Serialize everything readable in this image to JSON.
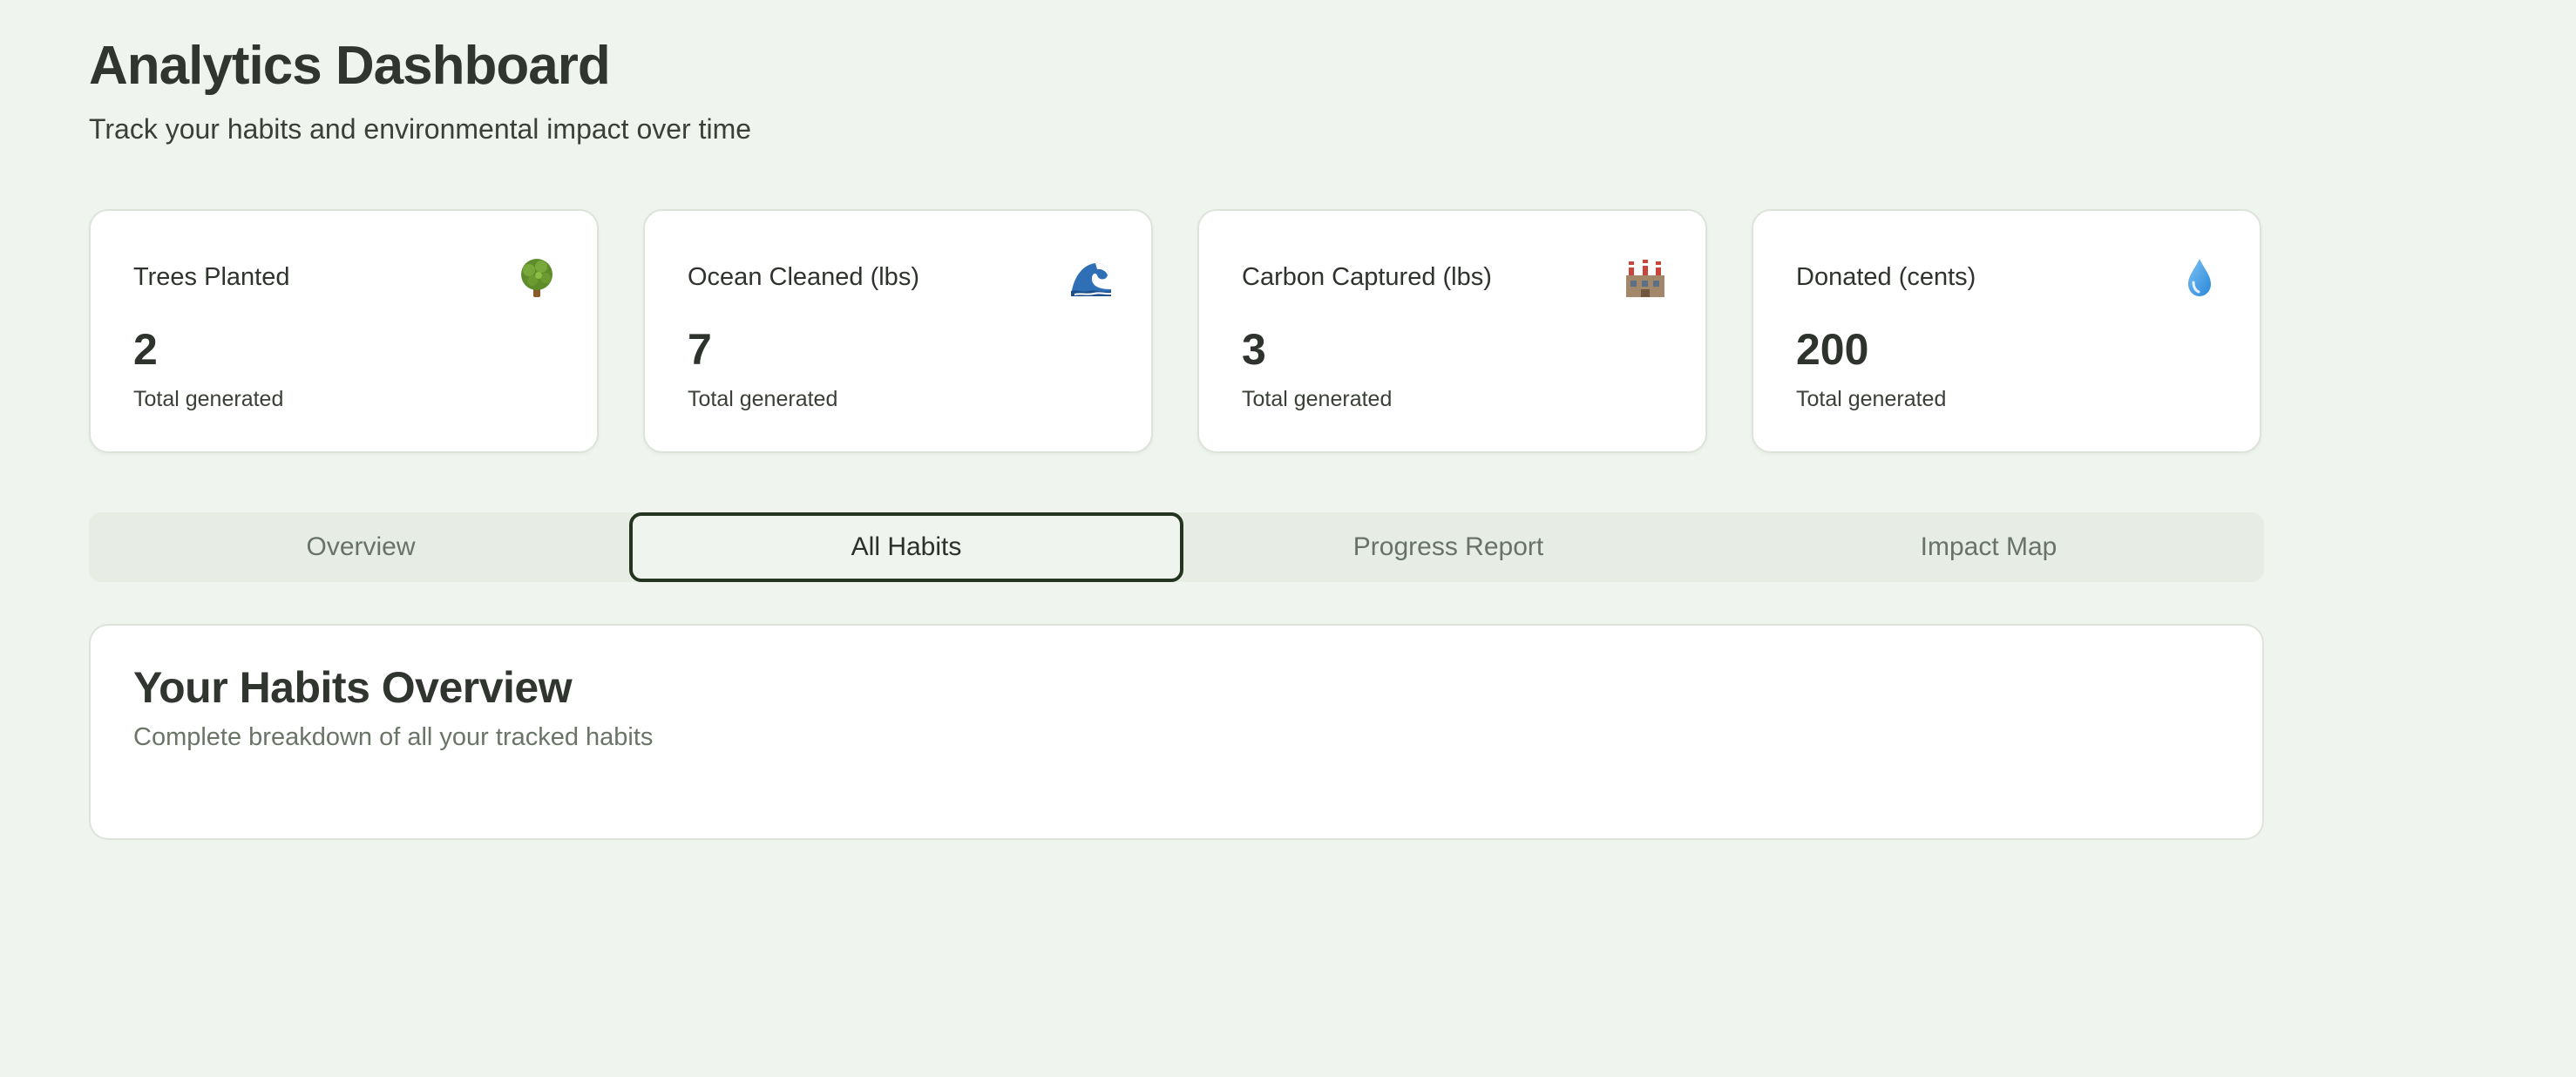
{
  "header": {
    "title": "Analytics Dashboard",
    "subtitle": "Track your habits and environmental impact over time"
  },
  "stats": [
    {
      "label": "Trees Planted",
      "value": "2",
      "note": "Total generated",
      "icon": "tree-icon"
    },
    {
      "label": "Ocean Cleaned (lbs)",
      "value": "7",
      "note": "Total generated",
      "icon": "wave-icon"
    },
    {
      "label": "Carbon Captured (lbs)",
      "value": "3",
      "note": "Total generated",
      "icon": "factory-icon"
    },
    {
      "label": "Donated (cents)",
      "value": "200",
      "note": "Total generated",
      "icon": "droplet-icon"
    }
  ],
  "tabs": [
    {
      "label": "Overview",
      "active": false
    },
    {
      "label": "All Habits",
      "active": true
    },
    {
      "label": "Progress Report",
      "active": false
    },
    {
      "label": "Impact Map",
      "active": false
    }
  ],
  "panel": {
    "title": "Your Habits Overview",
    "subtitle": "Complete breakdown of all your tracked habits"
  },
  "colors": {
    "background": "#eff4ee",
    "card": "#ffffff",
    "active_tab_border": "#23351f",
    "tab_bar": "#e7ede5"
  }
}
